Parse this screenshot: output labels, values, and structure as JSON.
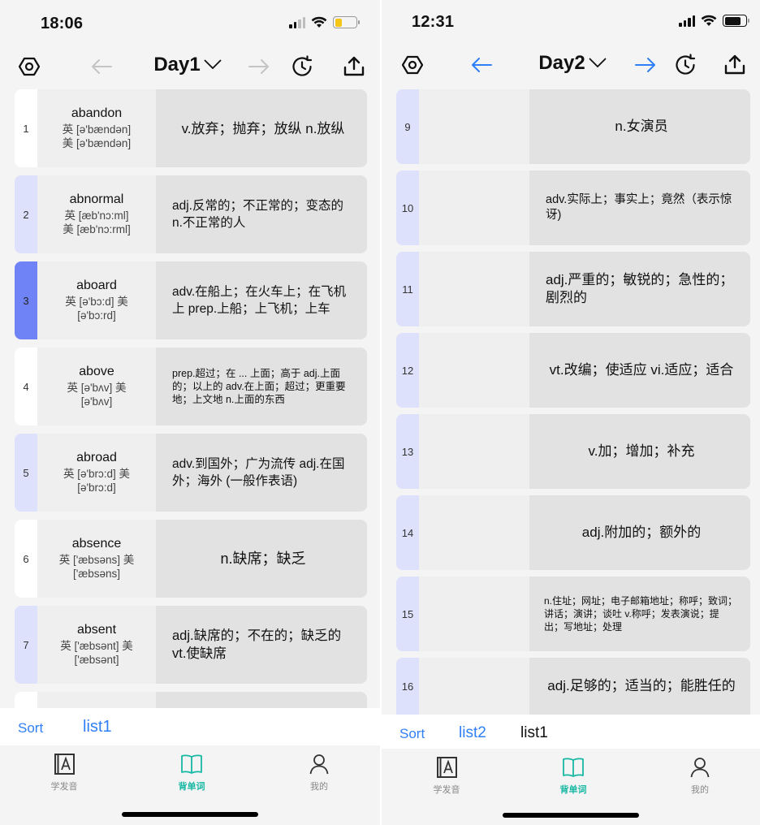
{
  "left": {
    "status": {
      "time": "18:06"
    },
    "nav": {
      "title": "Day1"
    },
    "items": [
      {
        "index": "1",
        "word": "abandon",
        "phon1": "英 [ə'bændən]",
        "phon2": "美 [ə'bændən]",
        "meaning": "v.放弃；抛弃；放纵 n.放纵"
      },
      {
        "index": "2",
        "word": "abnormal",
        "phon1": "英 [æb'nɔ:ml]",
        "phon2": "美 [æb'nɔ:rml]",
        "meaning": "adj.反常的；不正常的；变态的 n.不正常的人"
      },
      {
        "index": "3",
        "word": "aboard",
        "phon1": "英 [ə'bɔ:d] 美",
        "phon2": "[ə'bɔ:rd]",
        "meaning": "adv.在船上；在火车上；在飞机上 prep.上船；上飞机；上车"
      },
      {
        "index": "4",
        "word": "above",
        "phon1": "英 [ə'bʌv] 美",
        "phon2": "[ə'bʌv]",
        "meaning": "prep.超过；在 ... 上面；高于 adj.上面的；以上的 adv.在上面；超过；更重要地；上文地 n.上面的东西"
      },
      {
        "index": "5",
        "word": "abroad",
        "phon1": "英 [ə'brɔ:d] 美",
        "phon2": "[ə'brɔ:d]",
        "meaning": "adv.到国外；广为流传 adj.在国外；海外 (一般作表语)"
      },
      {
        "index": "6",
        "word": "absence",
        "phon1": "英 ['æbsəns] 美",
        "phon2": "['æbsəns]",
        "meaning": "n.缺席；缺乏"
      },
      {
        "index": "7",
        "word": "absent",
        "phon1": "英 ['æbsənt] 美",
        "phon2": "['æbsənt]",
        "meaning": "adj.缺席的；不在的；缺乏的 vt.使缺席"
      }
    ],
    "segment": {
      "sort": "Sort",
      "tab1": "list1"
    }
  },
  "right": {
    "status": {
      "time": "12:31"
    },
    "nav": {
      "title": "Day2"
    },
    "items": [
      {
        "index": "9",
        "meaning": "n.女演员"
      },
      {
        "index": "10",
        "meaning": "adv.实际上；事实上；竟然（表示惊讶)"
      },
      {
        "index": "11",
        "meaning": "adj.严重的；敏锐的；急性的；剧烈的"
      },
      {
        "index": "12",
        "meaning": "vt.改编；使适应 vi.适应；适合"
      },
      {
        "index": "13",
        "meaning": "v.加；增加；补充"
      },
      {
        "index": "14",
        "meaning": "adj.附加的；额外的"
      },
      {
        "index": "15",
        "meaning": "n.住址；网址；电子邮箱地址；称呼；致词；讲话；演讲；谈吐 v.称呼；发表演说；提出；写地址；处理"
      },
      {
        "index": "16",
        "meaning": "adj.足够的；适当的；能胜任的"
      }
    ],
    "segment": {
      "sort": "Sort",
      "tab1": "list2",
      "tab2": "list1"
    }
  },
  "tabs": {
    "pron": "学发音",
    "words": "背单词",
    "me": "我的"
  },
  "colors": {
    "accent_blue": "#2f7ff7",
    "active_index": "#6f83f6",
    "light_index": "#dde1fb",
    "tab_selected": "#16b8a3",
    "battery_low": "#f5c518"
  }
}
